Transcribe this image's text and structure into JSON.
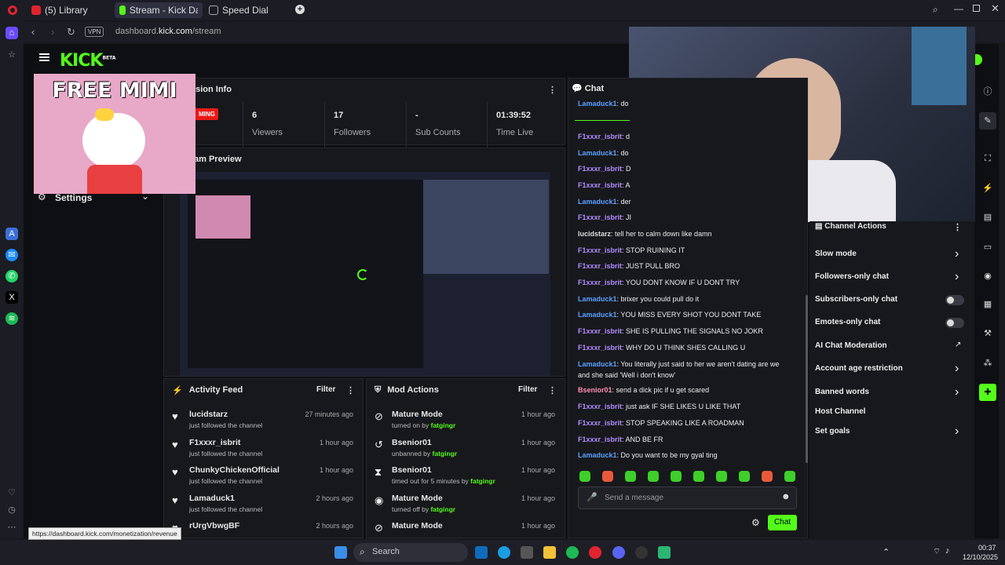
{
  "tabs": [
    {
      "label": "(5) Library"
    },
    {
      "label": "Stream - Kick Dashboard"
    },
    {
      "label": "Speed Dial"
    }
  ],
  "address": {
    "vpn": "VPN",
    "url_prefix": "dashboard.",
    "url_domain": "kick.com",
    "url_path": "/stream"
  },
  "brand": {
    "logo": "KICK",
    "beta": "BETA"
  },
  "overlay_text": "FREE MIMI",
  "left_menu": {
    "settings": "Settings"
  },
  "session": {
    "title": "ssion Info",
    "live_badge": "MING",
    "stats": [
      {
        "value": "6",
        "label": "Viewers"
      },
      {
        "value": "17",
        "label": "Followers"
      },
      {
        "value": "-",
        "label": "Sub Counts"
      },
      {
        "value": "01:39:52",
        "label": "Time Live"
      }
    ]
  },
  "preview": {
    "title": "am Preview"
  },
  "activity": {
    "title": "Activity Feed",
    "filter": "Filter",
    "items": [
      {
        "name": "lucidstarz",
        "sub": "just followed the channel",
        "time": "27 minutes ago"
      },
      {
        "name": "F1xxxr_isbrit",
        "sub": "just followed the channel",
        "time": "1 hour ago"
      },
      {
        "name": "ChunkyChickenOfficial",
        "sub": "just followed the channel",
        "time": "1 hour ago"
      },
      {
        "name": "Lamaduck1",
        "sub": "just followed the channel",
        "time": "2 hours ago"
      },
      {
        "name": "rUrgVbwgBF",
        "sub": "",
        "time": "2 hours ago"
      }
    ]
  },
  "mod": {
    "title": "Mod Actions",
    "filter": "Filter",
    "items": [
      {
        "name": "Mature Mode",
        "pre": "turned on by ",
        "by": "fatgingr",
        "time": "1 hour ago"
      },
      {
        "name": "Bsenior01",
        "pre": "unbanned by ",
        "by": "fatgingr",
        "time": "1 hour ago"
      },
      {
        "name": "Bsenior01",
        "pre": "timed out for 5 minutes by ",
        "by": "fatgingr",
        "time": "1 hour ago"
      },
      {
        "name": "Mature Mode",
        "pre": "turned off by ",
        "by": "fatgingr",
        "time": "1 hour ago"
      },
      {
        "name": "Mature Mode",
        "pre": "",
        "by": "",
        "time": "1 hour ago"
      }
    ]
  },
  "chat": {
    "title": "Chat",
    "lines": [
      {
        "user": "Lamaduck1",
        "msg": ": do",
        "cls": "u2"
      },
      {
        "user": "F1xxxr_isbrit",
        "msg": ": d",
        "cls": "u1"
      },
      {
        "user": "Lamaduck1",
        "msg": ": do",
        "cls": "u2"
      },
      {
        "user": "F1xxxr_isbrit",
        "msg": ": D",
        "cls": "u1"
      },
      {
        "user": "F1xxxr_isbrit",
        "msg": ": A",
        "cls": "u1"
      },
      {
        "user": "Lamaduck1",
        "msg": ": der",
        "cls": "u2"
      },
      {
        "user": "F1xxxr_isbrit",
        "msg": ": JI",
        "cls": "u1"
      },
      {
        "user": "lucidstarz",
        "msg": ": tell her to calm down like damn",
        "cls": "u3"
      },
      {
        "user": "F1xxxr_isbrit",
        "msg": ": STOP RUINING IT",
        "cls": "u1"
      },
      {
        "user": "F1xxxr_isbrit",
        "msg": ": JUST PULL BRO",
        "cls": "u1"
      },
      {
        "user": "F1xxxr_isbrit",
        "msg": ": YOU DONT KNOW IF U DONT TRY",
        "cls": "u1"
      },
      {
        "user": "Lamaduck1",
        "msg": ": brixer you could pull do it",
        "cls": "u2"
      },
      {
        "user": "Lamaduck1",
        "msg": ": YOU MISS EVERY SHOT YOU DONT TAKE",
        "cls": "u2"
      },
      {
        "user": "F1xxxr_isbrit",
        "msg": ": SHE IS PULLING THE SIGNALS NO JOKR",
        "cls": "u1"
      },
      {
        "user": "F1xxxr_isbrit",
        "msg": ": WHY DO U THINK SHES CALLING U",
        "cls": "u1"
      },
      {
        "user": "Lamaduck1",
        "msg": ": You literally just said to her we aren't dating are we",
        "cls": "u2"
      },
      {
        "user": "",
        "msg": "and she said 'Well i don't know'",
        "cls": "u2"
      },
      {
        "user": "Bsenior01",
        "msg": ": send a dick pic if u get scared",
        "cls": "u4"
      },
      {
        "user": "F1xxxr_isbrit",
        "msg": ": just ask IF SHE LIKES U LIKE THAT",
        "cls": "u1"
      },
      {
        "user": "F1xxxr_isbrit",
        "msg": ": STOP SPEAKING LIKE A ROADMAN",
        "cls": "u1"
      },
      {
        "user": "F1xxxr_isbrit",
        "msg": ": AND BE FR",
        "cls": "u1"
      },
      {
        "user": "Lamaduck1",
        "msg": ": Do you want to be my gyal ting",
        "cls": "u2"
      }
    ],
    "placeholder": "Send a message",
    "send": "Chat"
  },
  "channel_actions": {
    "title": "Channel Actions",
    "items": [
      {
        "label": "Slow mode",
        "kind": "chevron"
      },
      {
        "label": "Followers-only chat",
        "kind": "chevron"
      },
      {
        "label": "Subscribers-only chat",
        "kind": "toggle"
      },
      {
        "label": "Emotes-only chat",
        "kind": "toggle"
      },
      {
        "label": "AI Chat Moderation",
        "kind": "external"
      },
      {
        "label": "Account age restriction",
        "kind": "chevron"
      },
      {
        "label": "Banned words",
        "kind": "chevron"
      },
      {
        "label": "Host Channel",
        "kind": "none"
      },
      {
        "label": "Set goals",
        "kind": "chevron"
      }
    ]
  },
  "status_url": "https://dashboard.kick.com/monetization/revenue",
  "taskbar": {
    "search": "Search",
    "time": "00:37",
    "date": "12/10/2025"
  },
  "colors": {
    "accent": "#53fc18",
    "live": "#e91916"
  }
}
